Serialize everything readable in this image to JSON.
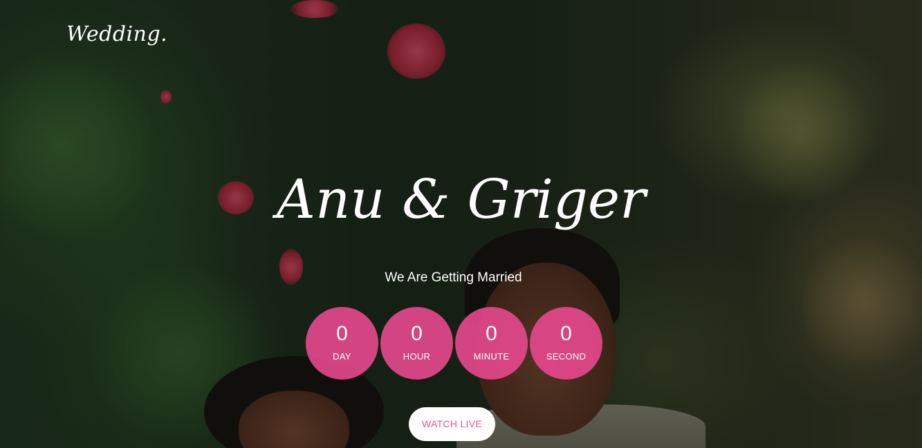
{
  "brand": {
    "logo_text": "Wedding."
  },
  "hero": {
    "couple_names": "Anu & Griger",
    "tagline": "We Are Getting Married"
  },
  "countdown": [
    {
      "value": "0",
      "label": "DAY"
    },
    {
      "value": "0",
      "label": "HOUR"
    },
    {
      "value": "0",
      "label": "MINUTE"
    },
    {
      "value": "0",
      "label": "SECOND"
    }
  ],
  "cta": {
    "watch_live_label": "WATCH LIVE"
  },
  "colors": {
    "accent_pink": "#e8488e",
    "button_text": "#e0578f",
    "text_white": "#ffffff"
  }
}
